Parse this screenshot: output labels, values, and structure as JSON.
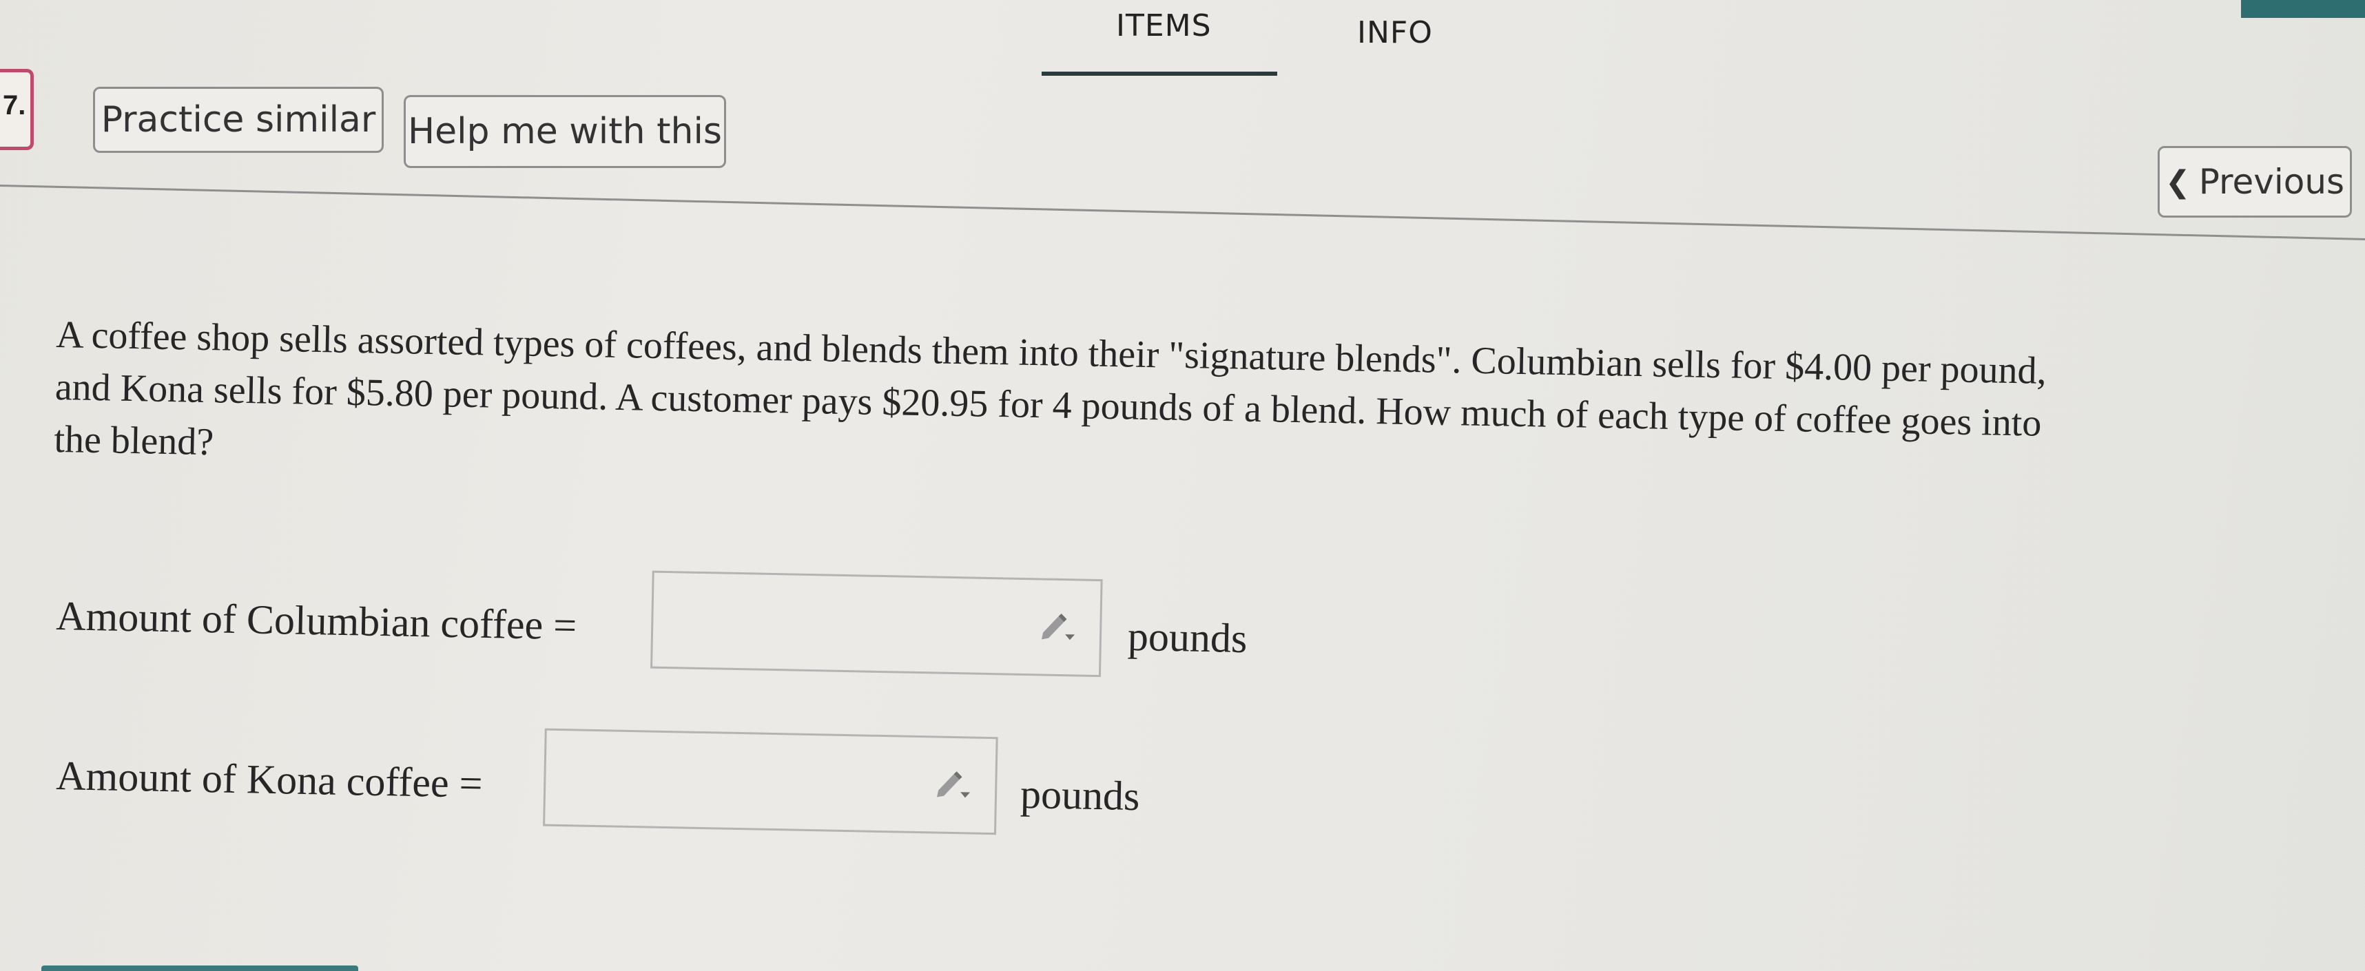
{
  "nav": {
    "tabs": [
      {
        "label": "ITEMS",
        "active": true
      },
      {
        "label": "INFO",
        "active": false
      }
    ]
  },
  "question_number": "7.",
  "toolbar": {
    "practice_label": "Practice similar",
    "help_label": "Help me with this",
    "previous_label": "Previous"
  },
  "question": {
    "lines": [
      "A coffee shop sells assorted types of coffees, and blends them into their \"signature blends\". Columbian sells for $4.00 per pound,",
      "and Kona sells for $5.80 per pound. A customer pays $20.95 for 4 pounds of a blend. How much of each type of coffee goes into",
      "the blend?"
    ]
  },
  "answers": [
    {
      "label": "Amount of Columbian coffee =",
      "value": "",
      "unit": "pounds"
    },
    {
      "label": "Amount of Kona coffee =",
      "value": "",
      "unit": "pounds"
    }
  ],
  "icons": {
    "pencil": "pencil-dropdown-icon",
    "chevron": "chevron-left-icon"
  },
  "colors": {
    "accent": "#2e6e70",
    "question_marker": "#c04a6a",
    "tab_underline": "#2b3a3a"
  }
}
